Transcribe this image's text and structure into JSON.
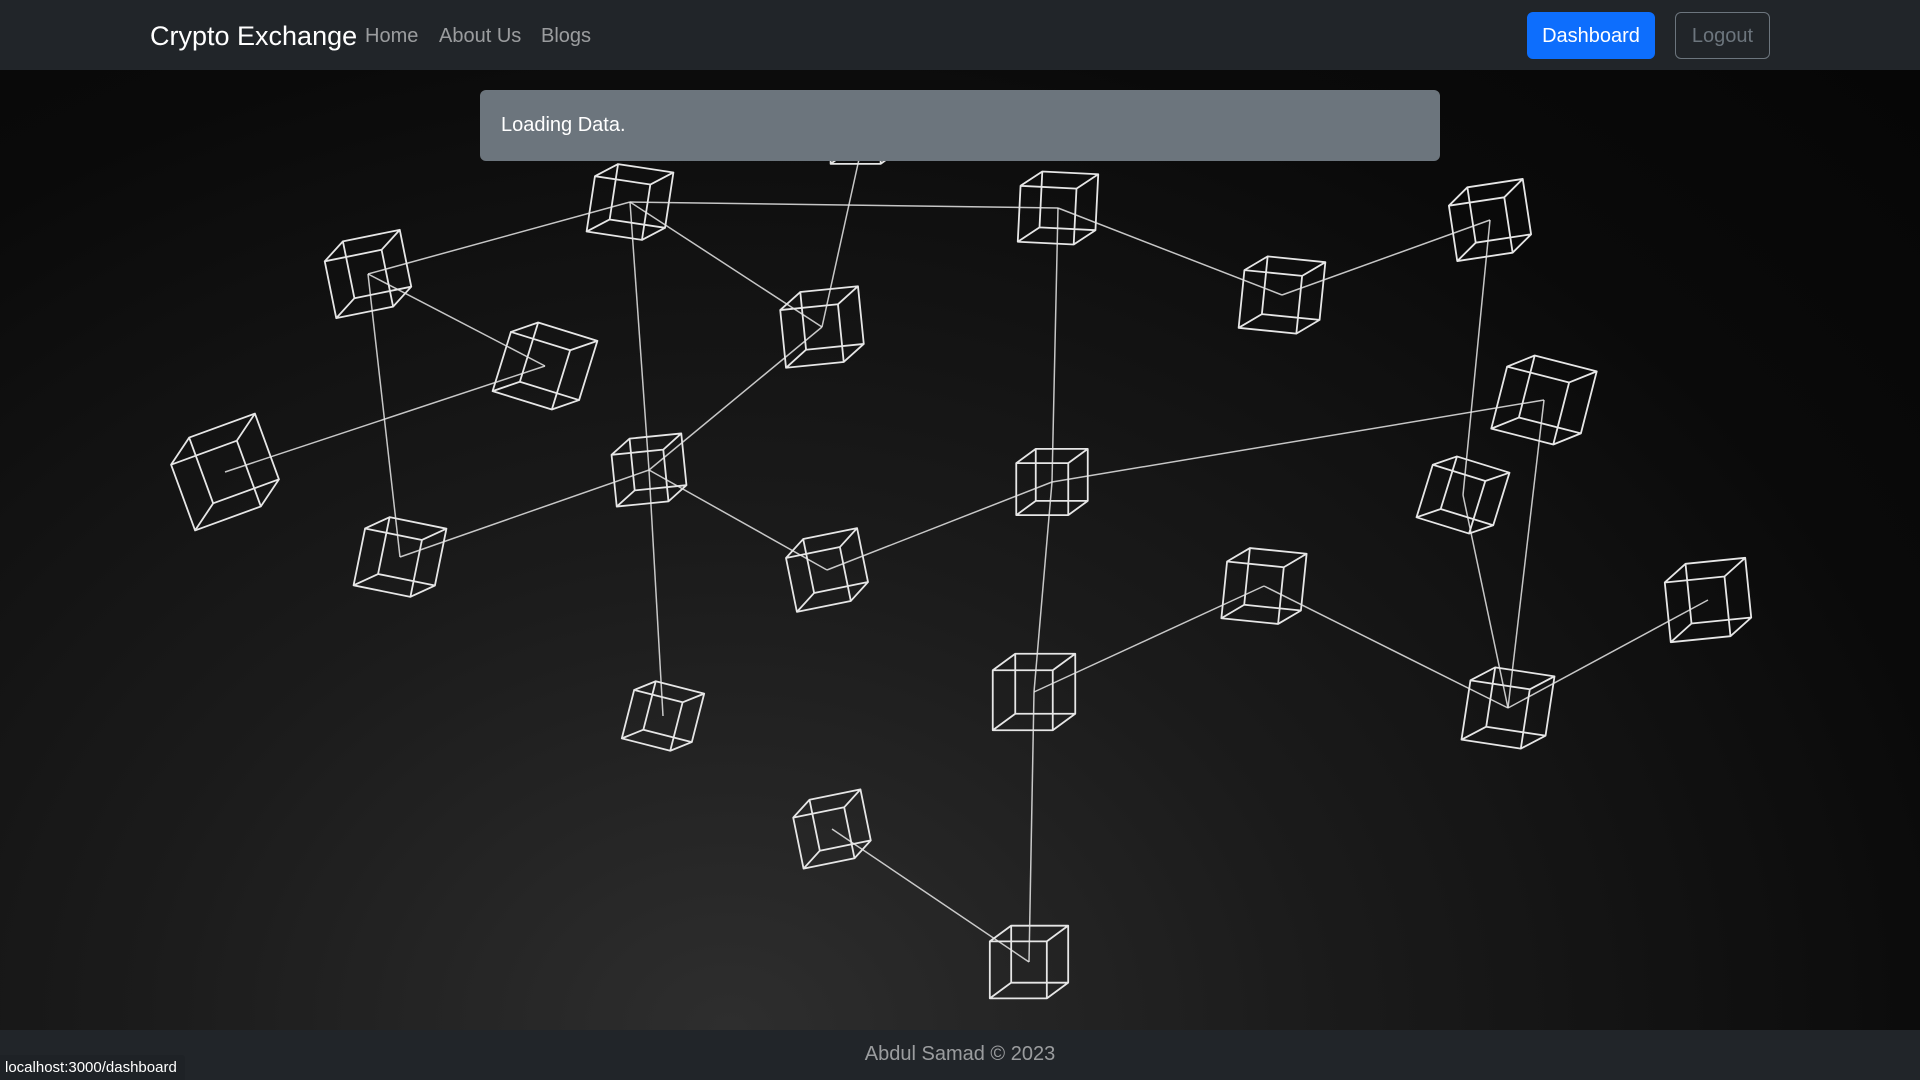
{
  "navbar": {
    "brand": "Crypto Exchange",
    "links": [
      "Home",
      "About Us",
      "Blogs"
    ],
    "dashboard_label": "Dashboard",
    "logout_label": "Logout"
  },
  "alert": {
    "message": "Loading Data."
  },
  "footer": {
    "text": "Abdul Samad © 2023"
  },
  "status_bar": {
    "url": "localhost:3000/dashboard"
  },
  "colors": {
    "navbar_bg": "#212529",
    "primary": "#0d6efd",
    "secondary": "#6c757d",
    "wireframe": "#e6e6e6"
  },
  "background": {
    "graphic": "blockchain-cube-network"
  }
}
